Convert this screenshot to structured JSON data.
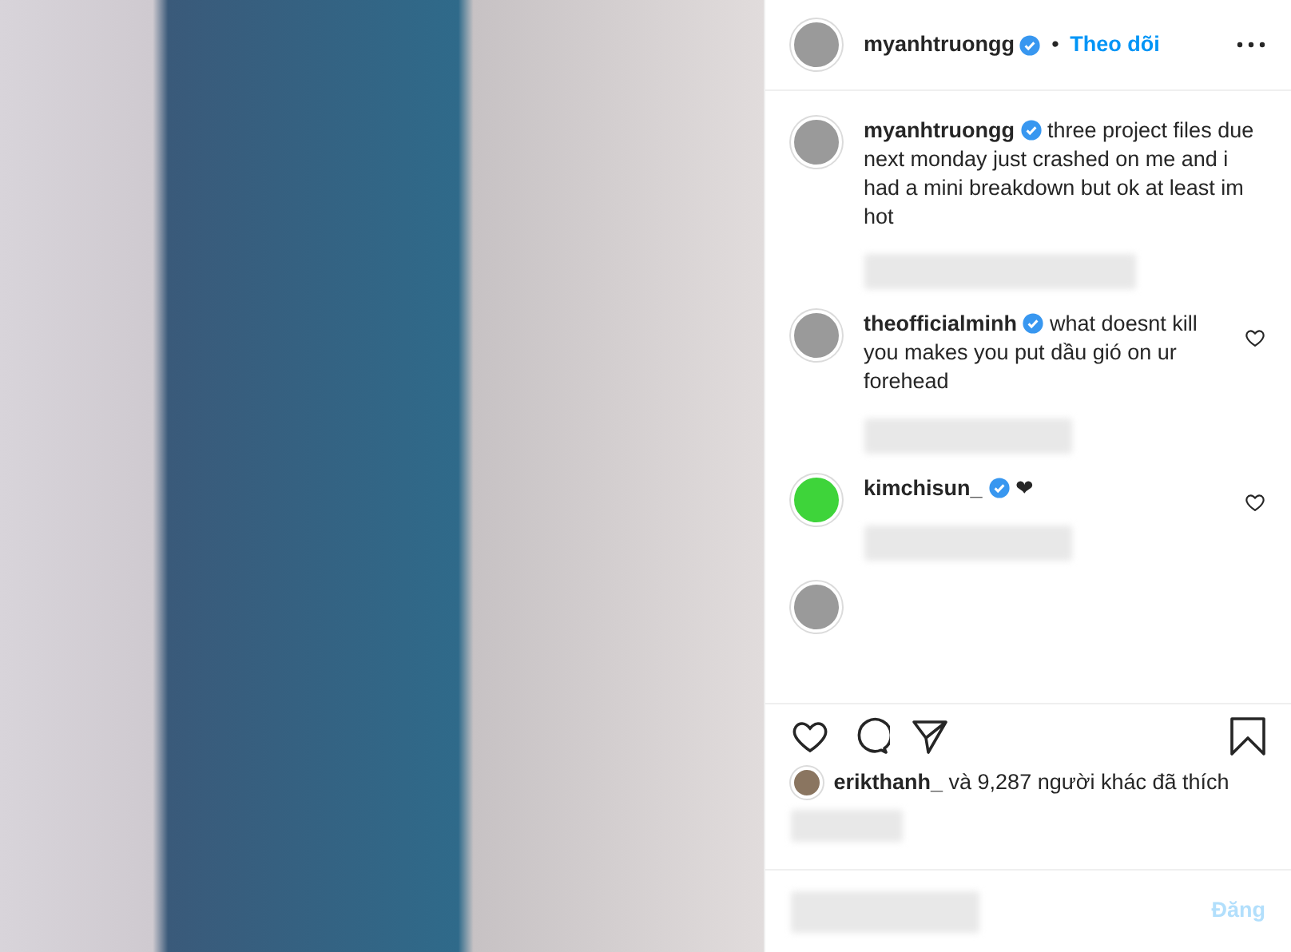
{
  "header": {
    "username": "myanhtruongg",
    "verified": true,
    "separator": "•",
    "follow": "Theo dõi"
  },
  "caption": {
    "username": "myanhtruongg",
    "verified": true,
    "text": "three project files due next monday just crashed on me and i had a mini breakdown but ok at least im hot"
  },
  "comments": [
    {
      "username": "theofficialminh",
      "verified": true,
      "text": "what doesnt kill you makes you put dầu gió on ur forehead",
      "color": "#9a9a9a"
    },
    {
      "username": "kimchisun_",
      "verified": true,
      "text": "❤",
      "color": "#3ed43a"
    }
  ],
  "likes": "**erikthanh_** và 9,287 người khác đã thích",
  "post_button": {
    "label": "Đăng",
    "disabled": true
  }
}
